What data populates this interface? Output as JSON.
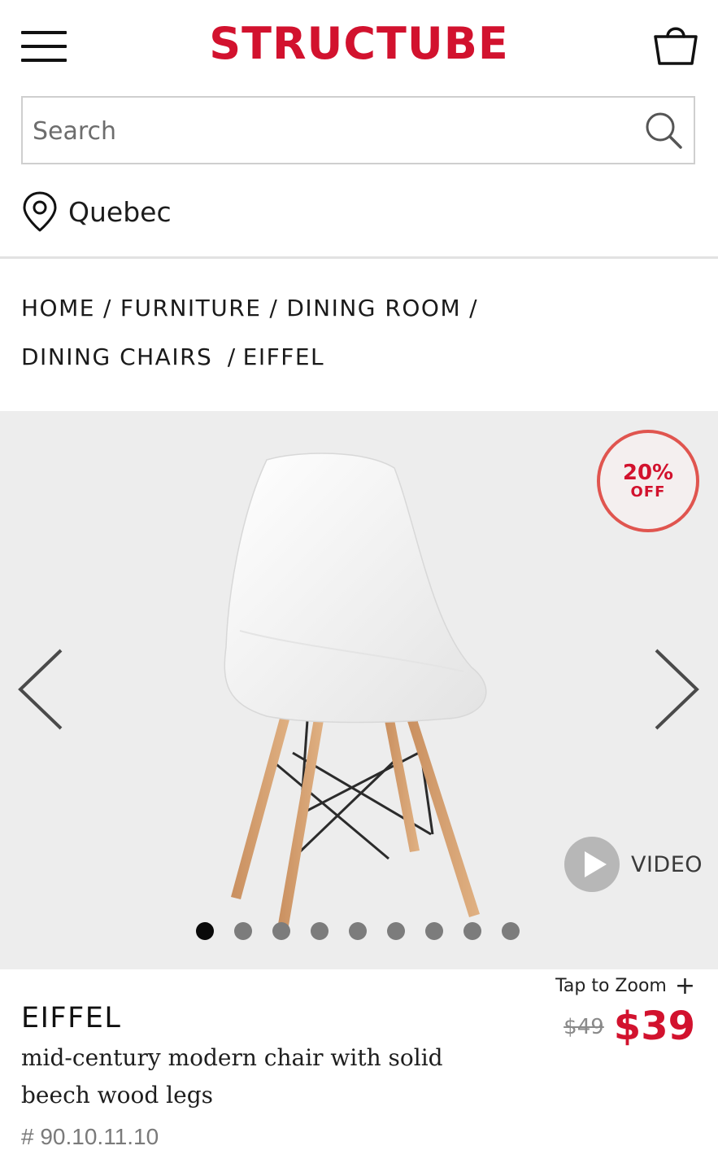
{
  "header": {
    "logo_text": "STRUCTUBE",
    "brand_color": "#d2122e",
    "menu_icon": "hamburger-icon",
    "cart_icon": "shopping-bag-icon"
  },
  "search": {
    "placeholder": "Search",
    "value": "",
    "icon": "search-icon"
  },
  "location": {
    "icon": "map-pin-icon",
    "label": "Quebec"
  },
  "breadcrumb": {
    "items": [
      "HOME",
      "FURNITURE",
      "DINING ROOM",
      "DINING CHAIRS",
      "EIFFEL"
    ],
    "separator": "/"
  },
  "gallery": {
    "discount": {
      "percent": "20%",
      "label": "OFF",
      "border_color": "#e0554f"
    },
    "prev_icon": "chevron-left-icon",
    "next_icon": "chevron-right-icon",
    "video": {
      "icon": "play-icon",
      "label": "VIDEO"
    },
    "image_count": 9,
    "active_index": 0
  },
  "product": {
    "zoom_label": "Tap to Zoom",
    "zoom_symbol": "+",
    "name": "EIFFEL",
    "description": "mid-century modern chair with solid beech wood legs",
    "sku": "# 90.10.11.10",
    "old_price": "$49",
    "price": "$39",
    "price_color": "#d2122e"
  }
}
